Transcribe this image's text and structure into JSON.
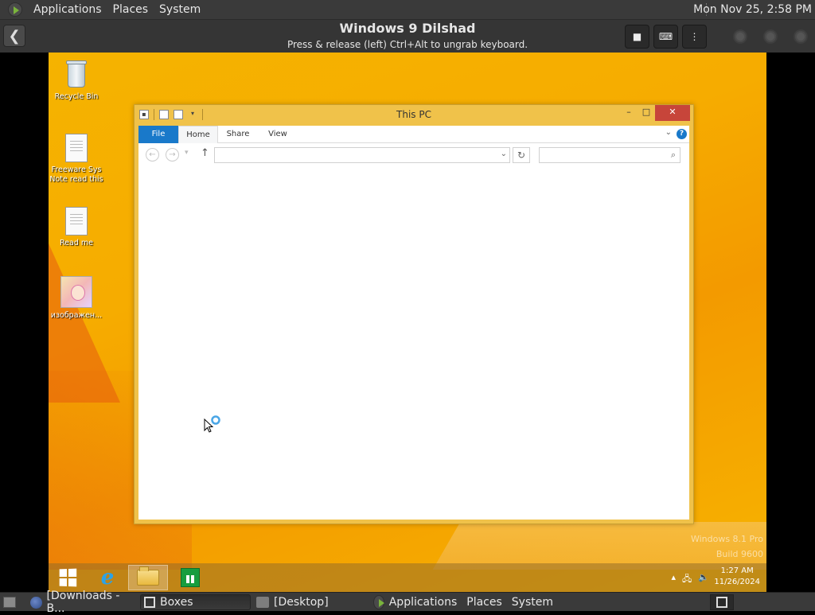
{
  "top_panel": {
    "menu": [
      "Applications",
      "Places",
      "System"
    ],
    "clock": "Mon Nov 25,  2:58 PM"
  },
  "boxes": {
    "vm_title": "Windows 9  Dilshad",
    "hint": "Press & release (left) Ctrl+Alt to ungrab keyboard."
  },
  "desktop": {
    "icons": [
      {
        "label": "Recycle Bin",
        "icon": "recycle-bin-icon"
      },
      {
        "label": "Freeware Sys Note read this",
        "icon": "text-document-icon"
      },
      {
        "label": "Read me",
        "icon": "text-document-icon"
      },
      {
        "label": "изображен...",
        "icon": "image-file-icon"
      }
    ]
  },
  "explorer": {
    "title": "This PC",
    "minimize": "–",
    "maximize": "□",
    "close": "✕",
    "ribbon_tabs": [
      "File",
      "Home",
      "Share",
      "View"
    ],
    "help": "?",
    "address_value": "",
    "search_placeholder": ""
  },
  "guest_taskbar": {
    "apps": [
      "start",
      "internet-explorer",
      "file-explorer",
      "store"
    ],
    "active_app": "file-explorer",
    "time": "1:27 AM",
    "date": "11/26/2024",
    "watermark": [
      "Windows 8.1 Pro",
      "Build 9600"
    ]
  },
  "bottom_panel": {
    "items": [
      {
        "label": "[Downloads - B...",
        "icon": "firefox-icon",
        "active": false
      },
      {
        "label": "Boxes",
        "icon": "boxes-icon",
        "active": true
      },
      {
        "label": "[Desktop]",
        "icon": "folder-icon",
        "active": false
      }
    ],
    "menu": [
      "Applications",
      "Places",
      "System"
    ]
  },
  "colors": {
    "desktop_accent": "#f5b300",
    "window_frame": "#f0c24a",
    "file_tab": "#1979ca",
    "close_button": "#c7453a"
  }
}
